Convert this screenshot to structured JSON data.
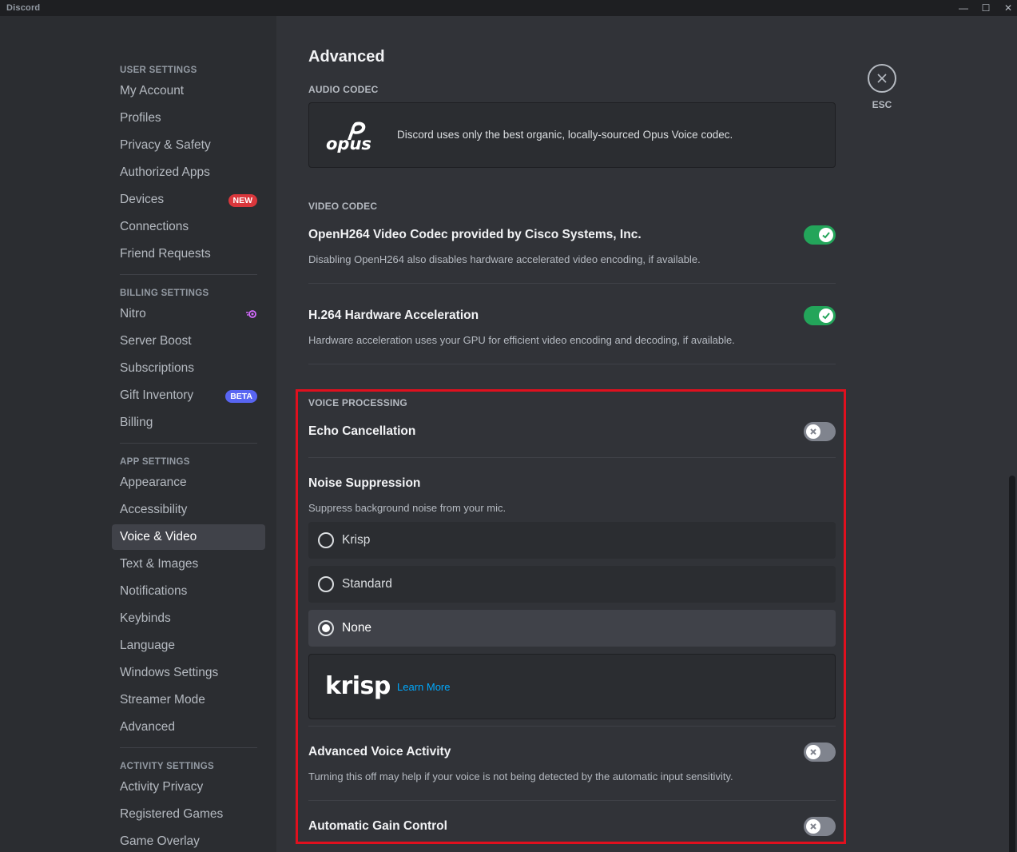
{
  "window": {
    "app_name": "Discord",
    "minimize": "—",
    "maximize": "☐",
    "close": "✕"
  },
  "sidebar": {
    "user_settings": {
      "label": "User Settings",
      "items": [
        "My Account",
        "Profiles",
        "Privacy & Safety",
        "Authorized Apps",
        "Devices",
        "Connections",
        "Friend Requests"
      ],
      "devices_badge": "NEW"
    },
    "billing_settings": {
      "label": "Billing Settings",
      "items": [
        "Nitro",
        "Server Boost",
        "Subscriptions",
        "Gift Inventory",
        "Billing"
      ],
      "gift_badge": "BETA"
    },
    "app_settings": {
      "label": "App Settings",
      "items": [
        "Appearance",
        "Accessibility",
        "Voice & Video",
        "Text & Images",
        "Notifications",
        "Keybinds",
        "Language",
        "Windows Settings",
        "Streamer Mode",
        "Advanced"
      ],
      "active": "Voice & Video"
    },
    "activity_settings": {
      "label": "Activity Settings",
      "items": [
        "Activity Privacy",
        "Registered Games",
        "Game Overlay"
      ]
    }
  },
  "main": {
    "title": "Advanced",
    "audio_codec": {
      "label": "Audio Codec",
      "logo_text": "opus",
      "description": "Discord uses only the best organic, locally-sourced Opus Voice codec."
    },
    "video_codec": {
      "label": "Video Codec",
      "openh264": {
        "title": "OpenH264 Video Codec provided by Cisco Systems, Inc.",
        "description": "Disabling OpenH264 also disables hardware accelerated video encoding, if available.",
        "enabled": true
      },
      "h264_hw": {
        "title": "H.264 Hardware Acceleration",
        "description": "Hardware acceleration uses your GPU for efficient video encoding and decoding, if available.",
        "enabled": true
      }
    },
    "voice_processing": {
      "label": "Voice Processing",
      "echo_cancellation": {
        "title": "Echo Cancellation",
        "enabled": false
      },
      "noise_suppression": {
        "title": "Noise Suppression",
        "description": "Suppress background noise from your mic.",
        "options": [
          "Krisp",
          "Standard",
          "None"
        ],
        "selected": "None"
      },
      "krisp_banner": {
        "logo_text": "krisp",
        "link": "Learn More"
      },
      "advanced_voice_activity": {
        "title": "Advanced Voice Activity",
        "description": "Turning this off may help if your voice is not being detected by the automatic input sensitivity.",
        "enabled": false
      },
      "automatic_gain_control": {
        "title": "Automatic Gain Control",
        "enabled": false
      }
    },
    "close": {
      "label": "ESC"
    }
  },
  "colors": {
    "toggle_on": "#23a55a",
    "toggle_off": "#80848e",
    "highlight": "#e0101e",
    "link": "#00a8fc"
  }
}
